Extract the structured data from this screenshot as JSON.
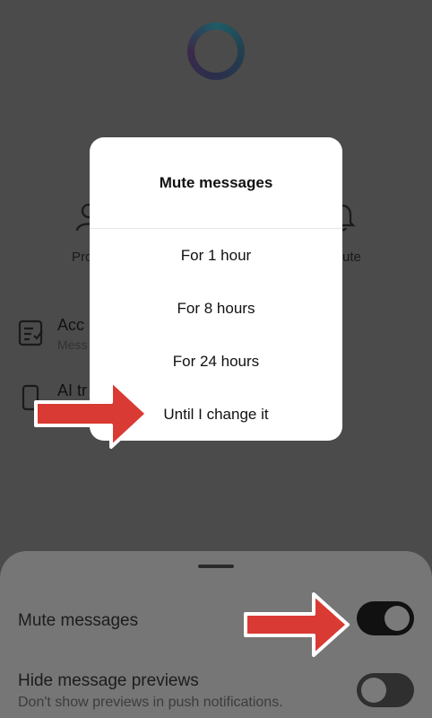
{
  "background": {
    "profile_label": "Pro",
    "mute_label": "ute",
    "account_title": "Acc",
    "account_sub": "Mess",
    "ai_title": "AI tr"
  },
  "dialog": {
    "title": "Mute messages",
    "options": [
      {
        "label": "For 1 hour"
      },
      {
        "label": "For 8 hours"
      },
      {
        "label": "For 24 hours"
      },
      {
        "label": "Until I change it"
      }
    ]
  },
  "sheet": {
    "mute_messages": {
      "label": "Mute messages",
      "enabled": true
    },
    "hide_previews": {
      "label": "Hide message previews",
      "sublabel": "Don't show previews in push notifications.",
      "enabled": false
    }
  },
  "colors": {
    "overlay": "#4b4b4b",
    "dialog_bg": "#ffffff",
    "arrow_fill": "#d93a33",
    "toggle_on": "#111111",
    "toggle_off": "#2f2f2f"
  }
}
